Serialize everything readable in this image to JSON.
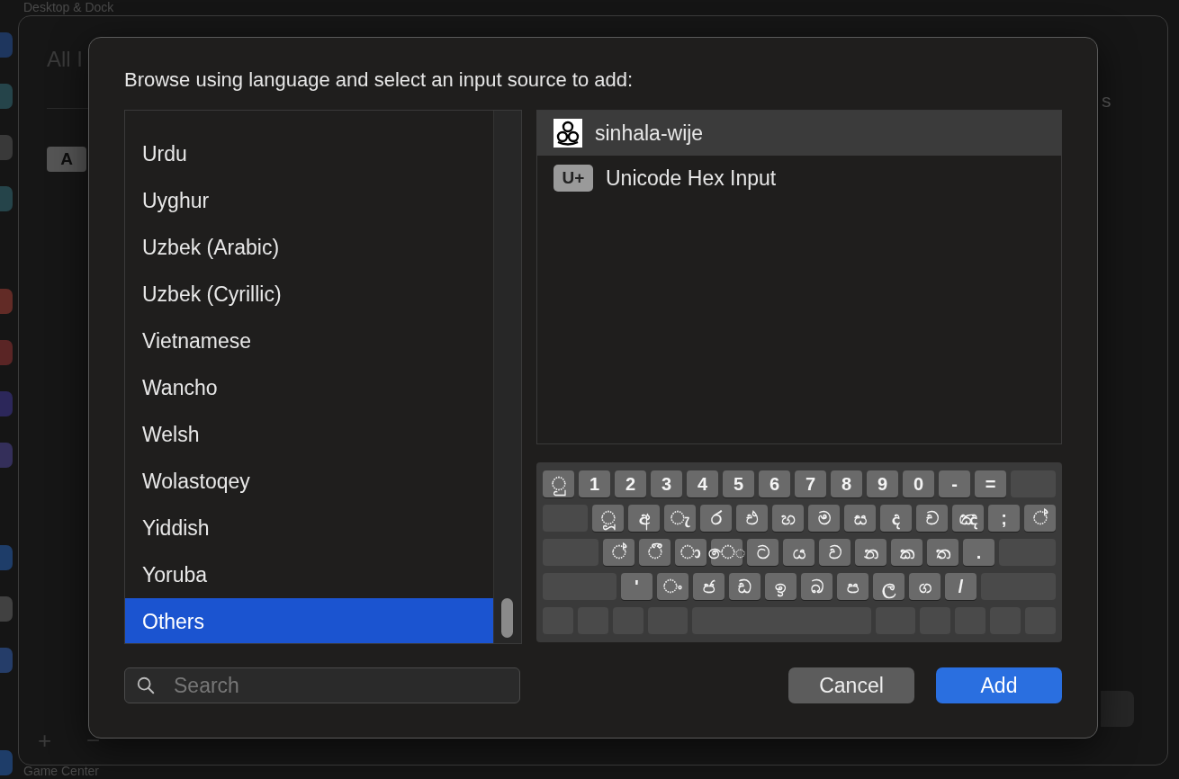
{
  "background": {
    "sidebar_title": "Desktop & Dock",
    "tab_label": "All I",
    "badge": "A",
    "partial_label": "s",
    "add_sign": "+",
    "remove_sign": "−",
    "footer_item": "Game Center"
  },
  "dialog": {
    "prompt": "Browse using language and select an input source to add:",
    "languages": [
      {
        "label": "Urdu",
        "selected": false
      },
      {
        "label": "Uyghur",
        "selected": false
      },
      {
        "label": "Uzbek (Arabic)",
        "selected": false
      },
      {
        "label": "Uzbek (Cyrillic)",
        "selected": false
      },
      {
        "label": "Vietnamese",
        "selected": false
      },
      {
        "label": "Wancho",
        "selected": false
      },
      {
        "label": "Welsh",
        "selected": false
      },
      {
        "label": "Wolastoqey",
        "selected": false
      },
      {
        "label": "Yiddish",
        "selected": false
      },
      {
        "label": "Yoruba",
        "selected": false
      },
      {
        "label": "Others",
        "selected": true
      }
    ],
    "sources": [
      {
        "label": "sinhala-wije",
        "kind": "script",
        "selected": true
      },
      {
        "label": "Unicode Hex Input",
        "kind": "badge",
        "badge": "U+",
        "selected": false
      }
    ],
    "keyboard": {
      "rows": [
        [
          "◌ු",
          "1",
          "2",
          "3",
          "4",
          "5",
          "6",
          "7",
          "8",
          "9",
          "0",
          "-",
          "="
        ],
        [
          "◌ූ",
          "අ",
          "◌ැ",
          "ර",
          "එ",
          "හ",
          "ම",
          "ස",
          "ද",
          "ච",
          "ඤ",
          ";",
          "◌්"
        ],
        [
          "◌්",
          "◌ී",
          "◌ා",
          "ෙ◌",
          "ට",
          "ය",
          "ව",
          "න",
          "ක",
          "ත",
          "."
        ],
        [
          "'",
          "◌ං",
          "ජ",
          "ඩ",
          "ඉ",
          "බ",
          "ප",
          "ල",
          "ග",
          "/"
        ]
      ]
    },
    "search": {
      "placeholder": "Search"
    },
    "buttons": [
      {
        "label": "Cancel",
        "kind": "secondary"
      },
      {
        "label": "Add",
        "kind": "primary"
      }
    ]
  }
}
